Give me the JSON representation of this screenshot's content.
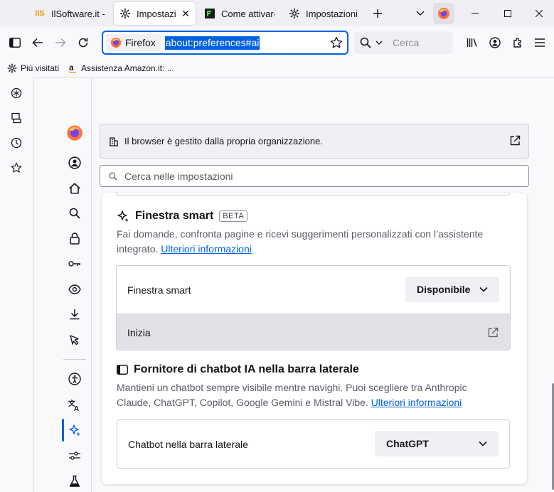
{
  "tabs": [
    {
      "title": "IlSoftware.it - Il",
      "favicon": "ilsoftware-logo",
      "active": false
    },
    {
      "title": "Impostazioni",
      "favicon": "gear-icon",
      "active": true
    },
    {
      "title": "Come attivare",
      "favicon": "terminal-icon",
      "active": false
    },
    {
      "title": "Impostazioni av",
      "favicon": "gear-icon",
      "active": false
    }
  ],
  "tab_logo_text": "IlS",
  "navbar": {
    "identity_label": "Firefox",
    "url": "about:preferences#ai",
    "search_placeholder": "Cerca"
  },
  "bookmarks": [
    {
      "label": "Più visitati",
      "icon": "gear-icon"
    },
    {
      "label": "Assistenza Amazon.it: ...",
      "icon": "amazon-icon"
    }
  ],
  "browser_sidebar_icons": [
    "ai-chatbot-icon",
    "synced-tabs-icon",
    "history-icon",
    "bookmarks-icon"
  ],
  "categories": [
    "firefox-logo",
    "account-icon",
    "home-icon",
    "search-icon",
    "privacy-lock-icon",
    "passwords-key-icon",
    "visibility-eye-icon",
    "downloads-icon",
    "cursor-icon",
    "accessibility-icon",
    "language-icon",
    "ai-sparkle-icon",
    "sliders-icon",
    "labs-flask-icon"
  ],
  "policy_notice": "Il browser è gestito dalla propria organizzazione.",
  "settings_search_placeholder": "Cerca nelle impostazioni",
  "smart_window": {
    "title": "Finestra smart",
    "badge": "BETA",
    "description_line1": "Fai domande, confronta pagine e ricevi suggerimenti personalizzati con l’assistente",
    "description_line2": "integrato.",
    "learn_more": "Ulteriori informazioni",
    "row_label": "Finestra smart",
    "select_value": "Disponibile",
    "start_label": "Inizia"
  },
  "sidebar_chatbot": {
    "title": "Fornitore di chatbot IA nella barra laterale",
    "description_line1": "Mantieni un chatbot sempre visibile mentre navighi. Puoi scegliere tra Anthropic",
    "description_line2": "Claude, ChatGPT, Copilot, Google Gemini e Mistral Vibe.",
    "learn_more": "Ulteriori informazioni",
    "row_label": "Chatbot nella barra laterale",
    "select_value": "ChatGPT"
  },
  "colors": {
    "accent": "#0061e0",
    "ilsoftware_orange": "#f39200",
    "firefox_orange": "#ff7139"
  }
}
